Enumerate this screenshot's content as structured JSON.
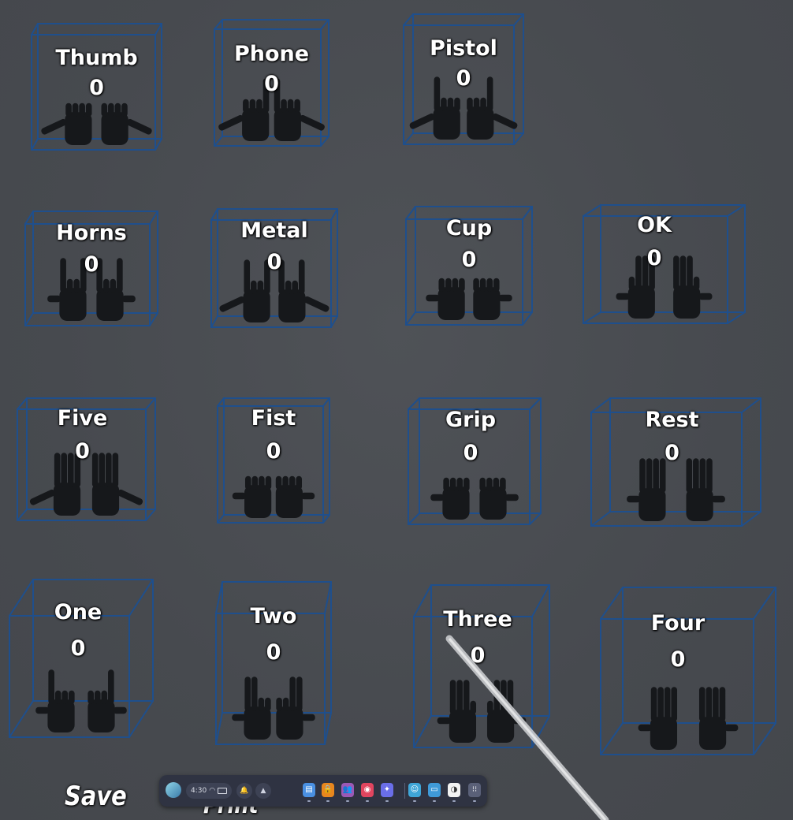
{
  "gestures": [
    {
      "name": "Thumb",
      "count": "0"
    },
    {
      "name": "Phone",
      "count": "0"
    },
    {
      "name": "Pistol",
      "count": "0"
    },
    {
      "name": "Horns",
      "count": "0"
    },
    {
      "name": "Metal",
      "count": "0"
    },
    {
      "name": "Cup",
      "count": "0"
    },
    {
      "name": "OK",
      "count": "0"
    },
    {
      "name": "Five",
      "count": "0"
    },
    {
      "name": "Fist",
      "count": "0"
    },
    {
      "name": "Grip",
      "count": "0"
    },
    {
      "name": "Rest",
      "count": "0"
    },
    {
      "name": "One",
      "count": "0"
    },
    {
      "name": "Two",
      "count": "0"
    },
    {
      "name": "Three",
      "count": "0"
    },
    {
      "name": "Four",
      "count": "0"
    }
  ],
  "buttons": {
    "save_label": "Save",
    "print_label": "Print"
  },
  "taskbar": {
    "time": "4:30",
    "apps": [
      {
        "icon": "store-icon",
        "color": "#4a90e2"
      },
      {
        "icon": "lock-icon",
        "color": "#e8871e"
      },
      {
        "icon": "people-icon",
        "color": "#9b59b6"
      },
      {
        "icon": "camera-icon",
        "color": "#e0455f"
      },
      {
        "icon": "messenger-icon",
        "color": "#6a6ee8"
      },
      {
        "icon": "avatar-app-icon",
        "color": "#3fa6d8"
      },
      {
        "icon": "files-icon",
        "color": "#3f9ad8"
      },
      {
        "icon": "browser-icon",
        "color": "#f2f2f2"
      },
      {
        "icon": "app-grid-icon",
        "color": "#5a6078"
      }
    ]
  },
  "colors": {
    "background": "#4a4d52",
    "cube_edge": "#1f4f8c",
    "hand": "#16181b",
    "label": "#ffffff"
  }
}
